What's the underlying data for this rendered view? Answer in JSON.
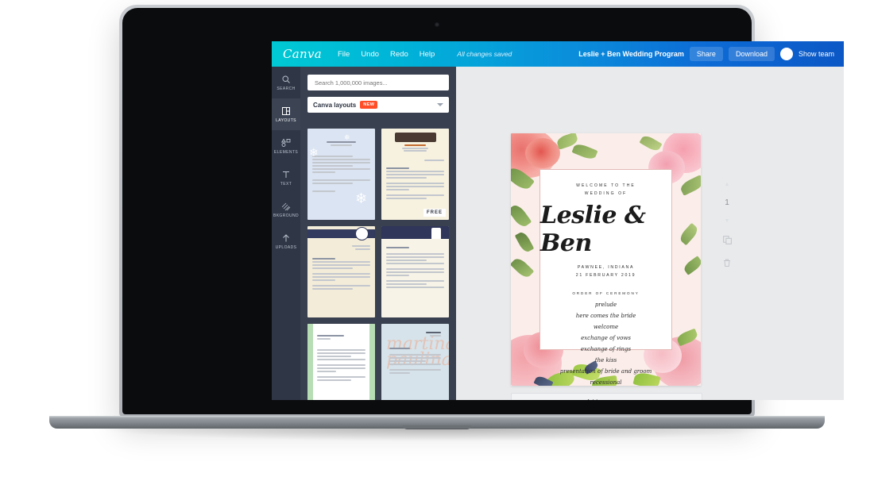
{
  "app": {
    "brand": "Canva",
    "menu": [
      "File",
      "Undo",
      "Redo",
      "Help"
    ],
    "save_status": "All changes saved",
    "document_title": "Leslie + Ben Wedding Program",
    "share_label": "Share",
    "download_label": "Download",
    "show_team_label": "Show team",
    "accent_cyan": "#00C9D4",
    "accent_blue": "#0B57C6"
  },
  "rail": {
    "items": [
      {
        "label": "SEARCH",
        "icon": "search-icon",
        "active": false
      },
      {
        "label": "LAYOUTS",
        "icon": "layouts-icon",
        "active": true
      },
      {
        "label": "ELEMENTS",
        "icon": "elements-icon",
        "active": false
      },
      {
        "label": "TEXT",
        "icon": "text-icon",
        "active": false
      },
      {
        "label": "BKGROUND",
        "icon": "background-icon",
        "active": false
      },
      {
        "label": "UPLOADS",
        "icon": "upload-icon",
        "active": false
      }
    ]
  },
  "panel": {
    "search_placeholder": "Search 1,000,000 images...",
    "search_value": "",
    "layouts_label": "Canva layouts",
    "new_badge": "NEW",
    "free_badge": "FREE"
  },
  "canvas": {
    "page_number": "1",
    "add_page_label": "+ Add a new page",
    "duplicate_icon": "duplicate-page-icon",
    "delete_icon": "trash-icon"
  },
  "design": {
    "welcome_line1": "WELCOME TO THE",
    "welcome_line2": "WEDDING OF",
    "couple_names": "Leslie & Ben",
    "location": "PAWNEE, INDIANA",
    "date": "21 FEBRUARY 2019",
    "order_title": "ORDER OF CEREMONY",
    "order_items": [
      "prelude",
      "here comes the bride",
      "welcome",
      "exchange of vows",
      "exchange of rings",
      "the kiss",
      "presentation of bride and groom",
      "recessional"
    ]
  }
}
